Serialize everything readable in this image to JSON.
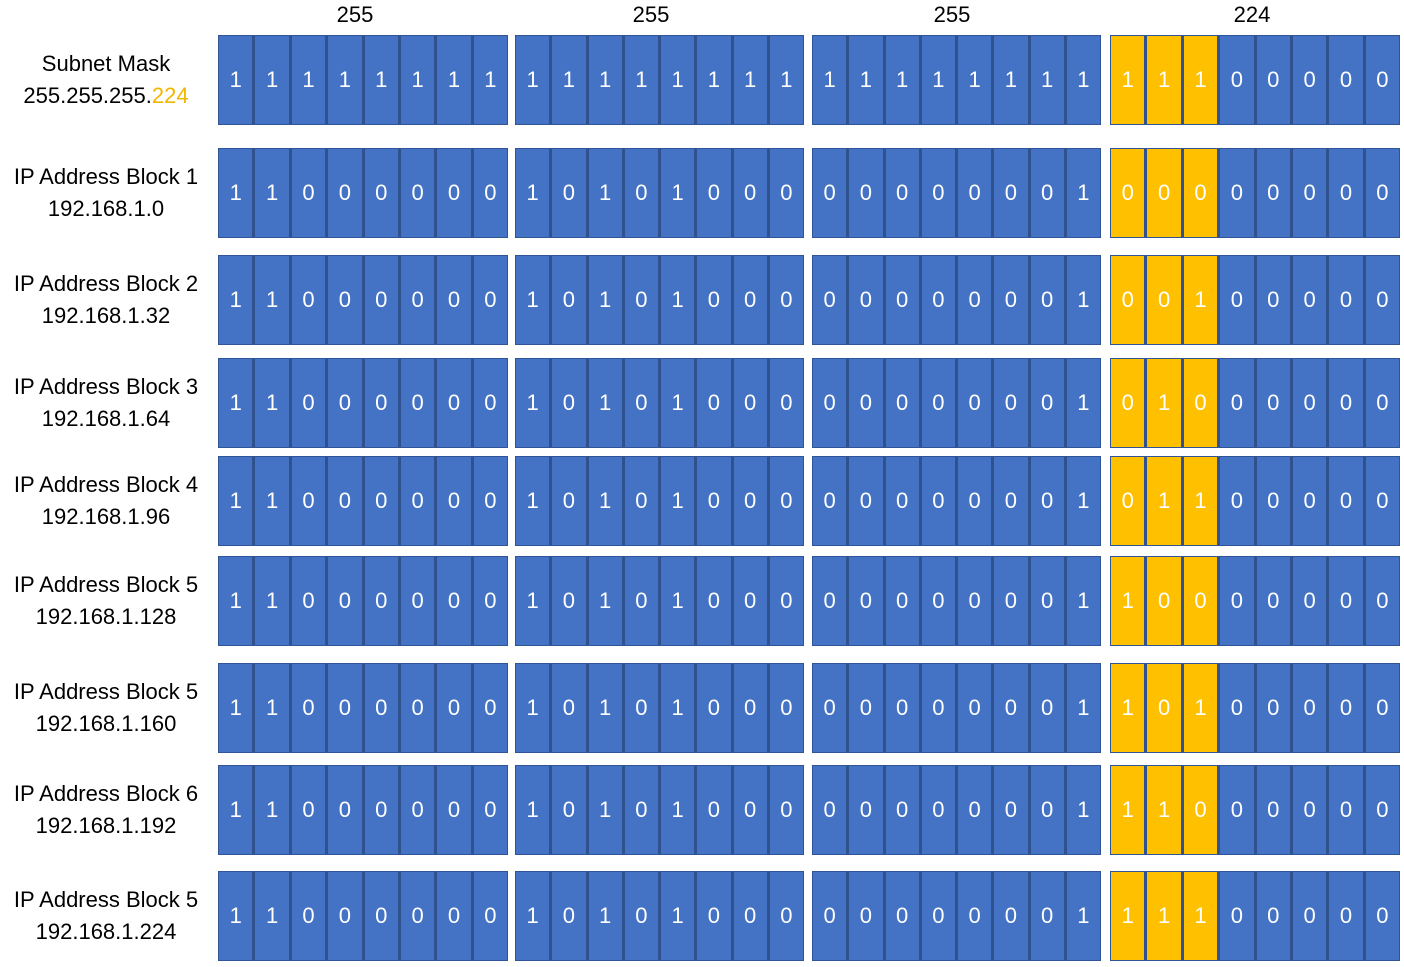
{
  "header": {
    "octets": [
      "255",
      "255",
      "255",
      "224"
    ]
  },
  "colors": {
    "bit_fill": "#4472C4",
    "highlight_fill": "#FFC000",
    "highlight_text": "#F2B600"
  },
  "rows": [
    {
      "label": "Subnet Mask",
      "value_prefix": "255.255.255.",
      "value_highlight": "224",
      "octets": [
        [
          "1",
          "1",
          "1",
          "1",
          "1",
          "1",
          "1",
          "1"
        ],
        [
          "1",
          "1",
          "1",
          "1",
          "1",
          "1",
          "1",
          "1"
        ],
        [
          "1",
          "1",
          "1",
          "1",
          "1",
          "1",
          "1",
          "1"
        ],
        [
          "1",
          "1",
          "1",
          "0",
          "0",
          "0",
          "0",
          "0"
        ]
      ]
    },
    {
      "label": "IP Address Block 1",
      "value_prefix": "192.168.1.0",
      "value_highlight": "",
      "octets": [
        [
          "1",
          "1",
          "0",
          "0",
          "0",
          "0",
          "0",
          "0"
        ],
        [
          "1",
          "0",
          "1",
          "0",
          "1",
          "0",
          "0",
          "0"
        ],
        [
          "0",
          "0",
          "0",
          "0",
          "0",
          "0",
          "0",
          "1"
        ],
        [
          "0",
          "0",
          "0",
          "0",
          "0",
          "0",
          "0",
          "0"
        ]
      ]
    },
    {
      "label": "IP Address Block 2",
      "value_prefix": "192.168.1.32",
      "value_highlight": "",
      "octets": [
        [
          "1",
          "1",
          "0",
          "0",
          "0",
          "0",
          "0",
          "0"
        ],
        [
          "1",
          "0",
          "1",
          "0",
          "1",
          "0",
          "0",
          "0"
        ],
        [
          "0",
          "0",
          "0",
          "0",
          "0",
          "0",
          "0",
          "1"
        ],
        [
          "0",
          "0",
          "1",
          "0",
          "0",
          "0",
          "0",
          "0"
        ]
      ]
    },
    {
      "label": "IP Address Block 3",
      "value_prefix": "192.168.1.64",
      "value_highlight": "",
      "octets": [
        [
          "1",
          "1",
          "0",
          "0",
          "0",
          "0",
          "0",
          "0"
        ],
        [
          "1",
          "0",
          "1",
          "0",
          "1",
          "0",
          "0",
          "0"
        ],
        [
          "0",
          "0",
          "0",
          "0",
          "0",
          "0",
          "0",
          "1"
        ],
        [
          "0",
          "1",
          "0",
          "0",
          "0",
          "0",
          "0",
          "0"
        ]
      ]
    },
    {
      "label": "IP Address Block 4",
      "value_prefix": "192.168.1.96",
      "value_highlight": "",
      "octets": [
        [
          "1",
          "1",
          "0",
          "0",
          "0",
          "0",
          "0",
          "0"
        ],
        [
          "1",
          "0",
          "1",
          "0",
          "1",
          "0",
          "0",
          "0"
        ],
        [
          "0",
          "0",
          "0",
          "0",
          "0",
          "0",
          "0",
          "1"
        ],
        [
          "0",
          "1",
          "1",
          "0",
          "0",
          "0",
          "0",
          "0"
        ]
      ]
    },
    {
      "label": "IP Address Block 5",
      "value_prefix": "192.168.1.128",
      "value_highlight": "",
      "octets": [
        [
          "1",
          "1",
          "0",
          "0",
          "0",
          "0",
          "0",
          "0"
        ],
        [
          "1",
          "0",
          "1",
          "0",
          "1",
          "0",
          "0",
          "0"
        ],
        [
          "0",
          "0",
          "0",
          "0",
          "0",
          "0",
          "0",
          "1"
        ],
        [
          "1",
          "0",
          "0",
          "0",
          "0",
          "0",
          "0",
          "0"
        ]
      ]
    },
    {
      "label": "IP Address Block 5",
      "value_prefix": "192.168.1.160",
      "value_highlight": "",
      "octets": [
        [
          "1",
          "1",
          "0",
          "0",
          "0",
          "0",
          "0",
          "0"
        ],
        [
          "1",
          "0",
          "1",
          "0",
          "1",
          "0",
          "0",
          "0"
        ],
        [
          "0",
          "0",
          "0",
          "0",
          "0",
          "0",
          "0",
          "1"
        ],
        [
          "1",
          "0",
          "1",
          "0",
          "0",
          "0",
          "0",
          "0"
        ]
      ]
    },
    {
      "label": "IP Address Block 6",
      "value_prefix": "192.168.1.192",
      "value_highlight": "",
      "octets": [
        [
          "1",
          "1",
          "0",
          "0",
          "0",
          "0",
          "0",
          "0"
        ],
        [
          "1",
          "0",
          "1",
          "0",
          "1",
          "0",
          "0",
          "0"
        ],
        [
          "0",
          "0",
          "0",
          "0",
          "0",
          "0",
          "0",
          "1"
        ],
        [
          "1",
          "1",
          "0",
          "0",
          "0",
          "0",
          "0",
          "0"
        ]
      ]
    },
    {
      "label": "IP Address Block 5",
      "value_prefix": "192.168.1.224",
      "value_highlight": "",
      "octets": [
        [
          "1",
          "1",
          "0",
          "0",
          "0",
          "0",
          "0",
          "0"
        ],
        [
          "1",
          "0",
          "1",
          "0",
          "1",
          "0",
          "0",
          "0"
        ],
        [
          "0",
          "0",
          "0",
          "0",
          "0",
          "0",
          "0",
          "1"
        ],
        [
          "1",
          "1",
          "1",
          "0",
          "0",
          "0",
          "0",
          "0"
        ]
      ]
    }
  ]
}
